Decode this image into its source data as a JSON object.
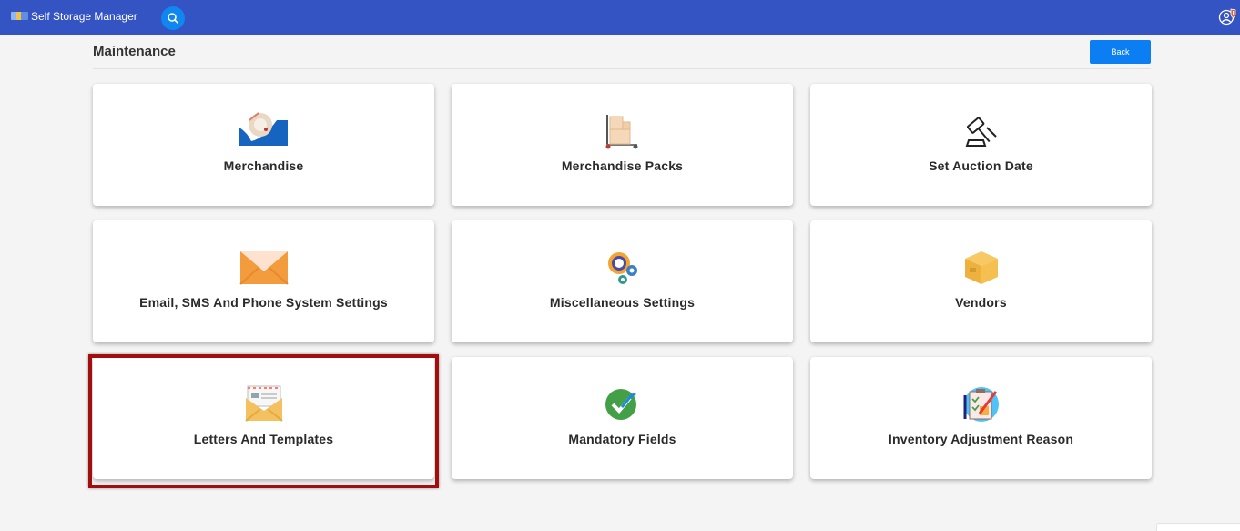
{
  "app": {
    "title": "Self Storage Manager"
  },
  "topbar": {
    "search_icon": "search-icon",
    "user_icon": "user-shield-icon"
  },
  "page": {
    "title": "Maintenance",
    "back_label": "Back"
  },
  "cards": [
    {
      "label": "Merchandise",
      "icon": "tape-roll-icon"
    },
    {
      "label": "Merchandise Packs",
      "icon": "hand-truck-boxes-icon"
    },
    {
      "label": "Set Auction Date",
      "icon": "gavel-icon"
    },
    {
      "label": "Email, SMS And Phone System Settings",
      "icon": "envelope-icon"
    },
    {
      "label": "Miscellaneous Settings",
      "icon": "gears-icon"
    },
    {
      "label": "Vendors",
      "icon": "box-icon"
    },
    {
      "label": "Letters And Templates",
      "icon": "open-letter-icon"
    },
    {
      "label": "Mandatory Fields",
      "icon": "checkmark-circle-icon"
    },
    {
      "label": "Inventory Adjustment Reason",
      "icon": "clipboard-pencil-icon"
    }
  ],
  "highlighted_card": "Letters And Templates",
  "colors": {
    "topbar": "#3454c4",
    "accent": "#0b7ef3",
    "highlight_border": "#a40d0d"
  }
}
